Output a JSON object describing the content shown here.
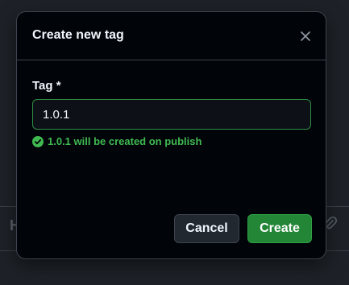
{
  "background": {
    "left_glyph": "H",
    "right_icon": "paperclip-icon"
  },
  "dialog": {
    "title": "Create new tag",
    "close_icon": "close-icon",
    "field_label": "Tag *",
    "input_value": "1.0.1",
    "validation_message": "1.0.1 will be created on publish",
    "validation_icon": "check-circle-icon",
    "cancel_label": "Cancel",
    "create_label": "Create"
  },
  "colors": {
    "dialog_bg": "#010409",
    "success": "#3fb950",
    "primary_button": "#238636"
  }
}
